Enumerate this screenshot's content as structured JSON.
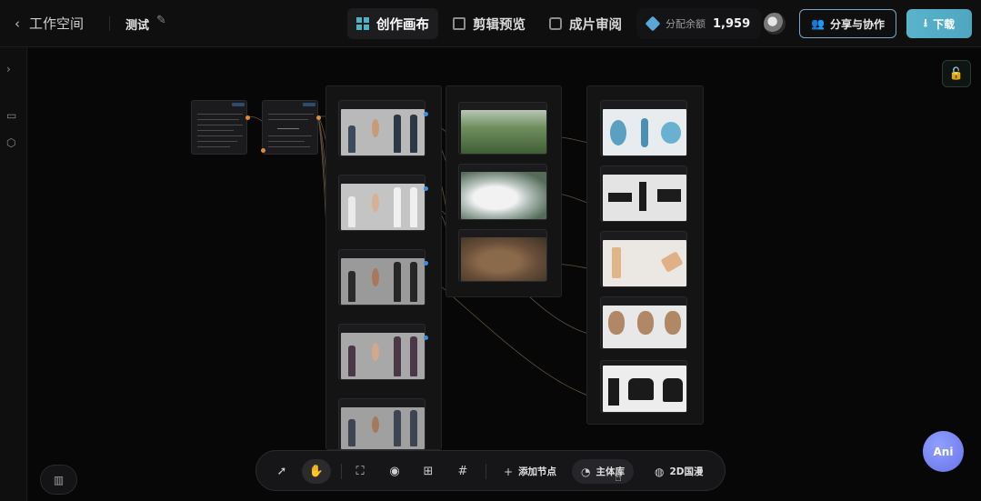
{
  "header": {
    "back_label": "工作空间",
    "project_name": "测试",
    "tabs": [
      {
        "label": "创作画布",
        "icon": "grid-icon",
        "active": true
      },
      {
        "label": "剪辑预览",
        "icon": "clapper-icon",
        "active": false
      },
      {
        "label": "成片审阅",
        "icon": "screen-icon",
        "active": false
      }
    ],
    "credits_label": "分配余额",
    "credits_value": "1,959",
    "share_label": "分享与协作",
    "download_label": "下载"
  },
  "toolbar": {
    "add_node_label": "添加节点",
    "subject_label": "主体库",
    "style_label": "2D国漫"
  },
  "assistant": {
    "label": "Ani"
  },
  "colors": {
    "accent": "#4fa6c0",
    "background": "#070707",
    "lock": "#4fd1a8",
    "assistant": "#6a72e8"
  }
}
